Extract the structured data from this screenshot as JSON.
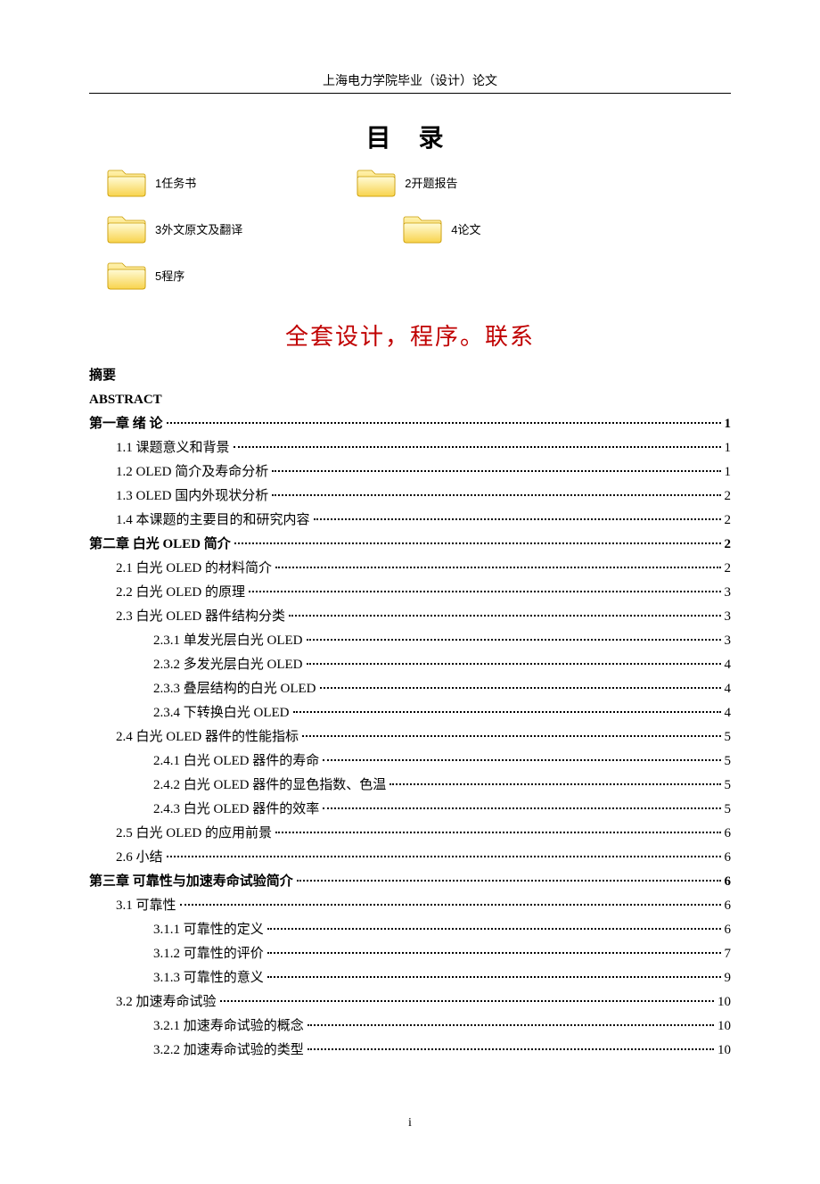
{
  "header": "上海电力学院毕业（设计）论文",
  "toc_title": "目  录",
  "folders": [
    [
      {
        "name": "folder-1",
        "label": "1任务书"
      },
      {
        "name": "folder-2",
        "label": "2开题报告"
      }
    ],
    [
      {
        "name": "folder-3",
        "label": "3外文原文及翻译"
      },
      {
        "name": "folder-4",
        "label": "4论文"
      }
    ],
    [
      {
        "name": "folder-5",
        "label": "5程序"
      }
    ]
  ],
  "subtitle": "全套设计，程序。联系",
  "toc": [
    {
      "level": 1,
      "bold": true,
      "label": "摘要",
      "page": ""
    },
    {
      "level": 1,
      "bold": true,
      "label": "ABSTRACT",
      "page": "",
      "en": true
    },
    {
      "level": 1,
      "bold": true,
      "label": "第一章  绪    论",
      "page": "1"
    },
    {
      "level": 2,
      "label": "1.1  课题意义和背景",
      "page": "1"
    },
    {
      "level": 2,
      "label": "1.2 OLED 简介及寿命分析",
      "page": "1"
    },
    {
      "level": 2,
      "label": "1.3 OLED 国内外现状分析",
      "page": "2"
    },
    {
      "level": 2,
      "label": "1.4  本课题的主要目的和研究内容",
      "page": "2"
    },
    {
      "level": 1,
      "bold": true,
      "label": "第二章  白光 OLED 简介",
      "page": "2"
    },
    {
      "level": 2,
      "label": "2.1  白光 OLED 的材料简介",
      "page": "2"
    },
    {
      "level": 2,
      "label": "2.2  白光 OLED 的原理",
      "page": "3"
    },
    {
      "level": 2,
      "label": "2.3  白光 OLED 器件结构分类",
      "page": "3"
    },
    {
      "level": 3,
      "label": "2.3.1  单发光层白光 OLED",
      "page": "3"
    },
    {
      "level": 3,
      "label": "2.3.2  多发光层白光 OLED",
      "page": "4"
    },
    {
      "level": 3,
      "label": "2.3.3  叠层结构的白光 OLED",
      "page": "4"
    },
    {
      "level": 3,
      "label": "2.3.4  下转换白光 OLED",
      "page": "4"
    },
    {
      "level": 2,
      "label": "2.4  白光 OLED 器件的性能指标",
      "page": "5"
    },
    {
      "level": 3,
      "label": "2.4.1  白光 OLED 器件的寿命",
      "page": "5"
    },
    {
      "level": 3,
      "label": "2.4.2  白光 OLED 器件的显色指数、色温",
      "page": "5"
    },
    {
      "level": 3,
      "label": "2.4.3  白光 OLED 器件的效率",
      "page": "5"
    },
    {
      "level": 2,
      "label": "2.5  白光 OLED 的应用前景",
      "page": "6"
    },
    {
      "level": 2,
      "label": "2.6  小结",
      "page": "6"
    },
    {
      "level": 1,
      "bold": true,
      "label": "第三章  可靠性与加速寿命试验简介",
      "page": "6"
    },
    {
      "level": 2,
      "label": "3.1  可靠性",
      "page": "6"
    },
    {
      "level": 3,
      "label": "3.1.1  可靠性的定义",
      "page": "6"
    },
    {
      "level": 3,
      "label": "3.1.2  可靠性的评价",
      "page": "7"
    },
    {
      "level": 3,
      "label": "3.1.3  可靠性的意义",
      "page": "9"
    },
    {
      "level": 2,
      "label": "3.2  加速寿命试验",
      "page": "10"
    },
    {
      "level": 3,
      "label": "3.2.1  加速寿命试验的概念",
      "page": "10"
    },
    {
      "level": 3,
      "label": "3.2.2  加速寿命试验的类型",
      "page": "10"
    }
  ],
  "page_number": "i"
}
